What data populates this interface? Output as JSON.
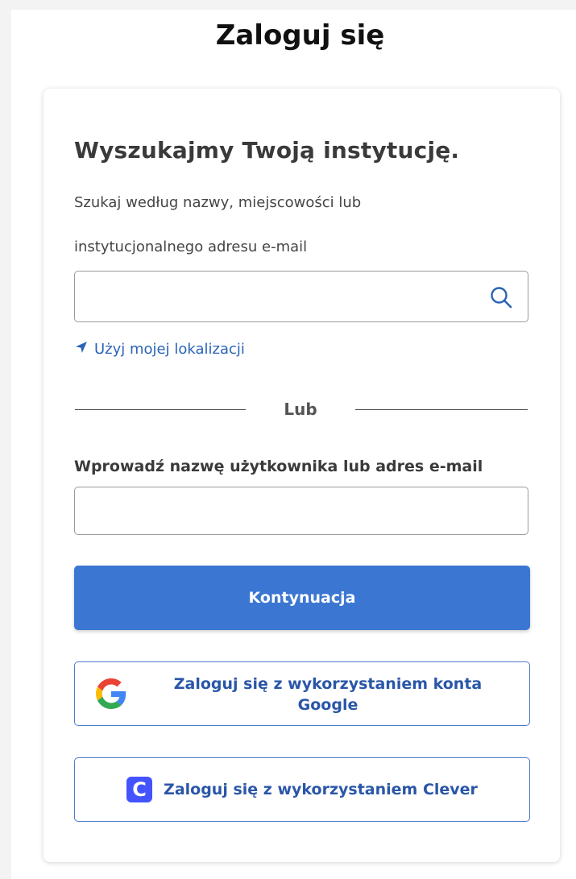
{
  "page": {
    "title": "Zaloguj się"
  },
  "institution_search": {
    "heading": "Wyszukajmy Twoją instytucję.",
    "helper_line1": "Szukaj według nazwy, miejscowości lub",
    "helper_line2": "instytucjonalnego adresu e-mail",
    "input_value": "",
    "placeholder": "",
    "search_icon": "magnifier-icon",
    "location_icon": "location-arrow-icon",
    "location_link": "Użyj mojej lokalizacji"
  },
  "divider": {
    "text": "Lub"
  },
  "username": {
    "label": "Wprowadź nazwę użytkownika lub adres e-mail",
    "value": "",
    "placeholder": ""
  },
  "actions": {
    "continue_label": "Kontynuacja",
    "google_label": "Zaloguj się z wykorzystaniem konta Google",
    "google_icon": "google-g-icon",
    "clever_label": "Zaloguj się z wykorzystaniem Clever",
    "clever_icon_letter": "C"
  },
  "colors": {
    "primary": "#3b76d2",
    "link": "#2b64b7",
    "sso_text": "#2a56a8",
    "clever_brand": "#4353ff"
  }
}
